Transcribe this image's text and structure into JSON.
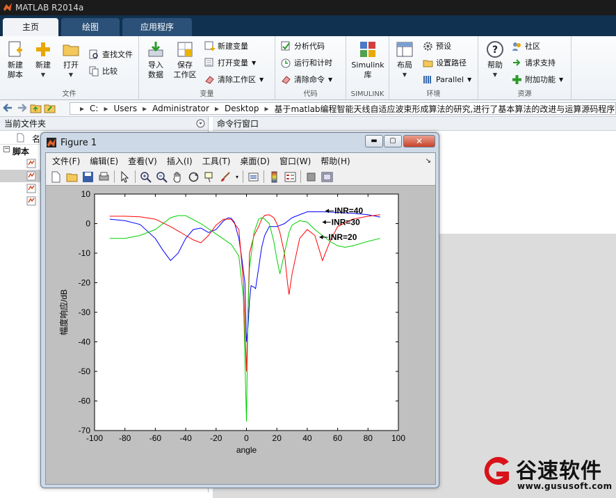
{
  "app": {
    "title": "MATLAB R2014a"
  },
  "tabs": [
    {
      "label": "主页"
    },
    {
      "label": "绘图"
    },
    {
      "label": "应用程序"
    }
  ],
  "ribbon": {
    "file": {
      "group": "文件",
      "new_script": "新建\n脚本",
      "new": "新建",
      "open": "打开",
      "find_files": "查找文件",
      "compare": "比较"
    },
    "variable": {
      "group": "变量",
      "import": "导入\n数据",
      "save_ws": "保存\n工作区",
      "new_var": "新建变量",
      "open_var": "打开变量",
      "clear_ws": "清除工作区"
    },
    "code": {
      "group": "代码",
      "analyze": "分析代码",
      "run_time": "运行和计时",
      "clear_cmd": "清除命令"
    },
    "simulink": {
      "group": "SIMULINK",
      "simulink_lib": "Simulink\n库"
    },
    "env": {
      "group": "环境",
      "layout": "布局",
      "prefs": "预设",
      "set_path": "设置路径",
      "parallel": "Parallel"
    },
    "resources": {
      "group": "资源",
      "help": "帮助",
      "community": "社区",
      "support": "请求支持",
      "addons": "附加功能"
    }
  },
  "address": {
    "crumbs": [
      "C:",
      "Users",
      "Administrator",
      "Desktop",
      "基于matlab编程智能天线自适应波束形成算法的研究,进行了基本算法的改进与运算源码程序"
    ]
  },
  "left_panel": {
    "title": "当前文件夹",
    "col_header": "名",
    "tree_root": "脚本"
  },
  "right_panel": {
    "title": "命令行窗口"
  },
  "figure": {
    "title": "Figure 1",
    "menus": [
      "文件(F)",
      "编辑(E)",
      "查看(V)",
      "插入(I)",
      "工具(T)",
      "桌面(D)",
      "窗口(W)",
      "帮助(H)"
    ]
  },
  "chart_data": {
    "type": "line",
    "xlabel": "angle",
    "ylabel": "幅度响应/dB",
    "xlim": [
      -100,
      100
    ],
    "ylim": [
      -70,
      10
    ],
    "xticks": [
      -100,
      -80,
      -60,
      -40,
      -20,
      0,
      20,
      40,
      60,
      80,
      100
    ],
    "yticks": [
      10,
      0,
      -10,
      -20,
      -30,
      -40,
      -50,
      -60,
      -70
    ],
    "grid": false,
    "annotations": [
      {
        "text": "INR=40",
        "x": 52,
        "y": 4.3
      },
      {
        "text": "INR=30",
        "x": 50,
        "y": 0.5
      },
      {
        "text": "INR=20",
        "x": 48,
        "y": -4.6
      }
    ],
    "series": [
      {
        "color": "#0000ff",
        "x": [
          -90,
          -80,
          -70,
          -60,
          -55,
          -50,
          -45,
          -40,
          -35,
          -30,
          -25,
          -20,
          -15,
          -12,
          -10,
          -8,
          -5,
          -3,
          -1,
          0,
          1,
          2,
          3,
          5,
          6,
          8,
          10,
          12,
          15,
          20,
          25,
          30,
          40,
          50,
          60,
          70,
          80,
          88
        ],
        "y": [
          1.5,
          1,
          -0.3,
          -5,
          -9,
          -12.5,
          -10,
          -5,
          -2,
          -1.5,
          -3,
          -2,
          1,
          2,
          1.8,
          0.5,
          -5,
          -12,
          -20,
          -40,
          -35,
          -26,
          -21,
          -21.5,
          -22,
          -15,
          -8,
          -4,
          -1,
          -1,
          0,
          2,
          4,
          4,
          3.8,
          3.5,
          3,
          2.2
        ]
      },
      {
        "color": "#ff0000",
        "x": [
          -90,
          -80,
          -70,
          -60,
          -50,
          -45,
          -40,
          -35,
          -30,
          -25,
          -20,
          -15,
          -10,
          -5,
          -2,
          0,
          2,
          5,
          8,
          10,
          12,
          15,
          18,
          20,
          22,
          25,
          27,
          28,
          30,
          35,
          40,
          45,
          48,
          50,
          55,
          60,
          70,
          80,
          88
        ],
        "y": [
          2.5,
          2.5,
          2.3,
          1.5,
          -1,
          -2.5,
          -4,
          -5.5,
          -6.5,
          -4,
          -0.5,
          1.5,
          1.5,
          -2,
          -20,
          -50,
          -10,
          -4,
          -1,
          1.5,
          2.8,
          3,
          2,
          0,
          -3,
          -10,
          -20,
          -24,
          -17,
          -5,
          -2,
          -4,
          -9,
          -12.5,
          -6,
          -1,
          1.5,
          2.5,
          3
        ]
      },
      {
        "color": "#00d000",
        "x": [
          -90,
          -80,
          -70,
          -60,
          -55,
          -50,
          -45,
          -40,
          -30,
          -20,
          -10,
          -5,
          -2,
          0,
          1,
          2,
          5,
          8,
          10,
          12,
          15,
          18,
          20,
          22,
          25,
          28,
          30,
          35,
          40,
          45,
          50,
          55,
          60,
          65,
          70,
          80,
          88
        ],
        "y": [
          -5,
          -5,
          -4,
          -2,
          0,
          2,
          2.7,
          2.7,
          0,
          -3.5,
          -7,
          -11,
          -25,
          -67,
          -30,
          -15,
          -3,
          1.5,
          2,
          1.5,
          0,
          -6,
          -12,
          -17,
          -10,
          -3,
          -0.5,
          1,
          0.5,
          -2,
          -4,
          -6,
          -7.5,
          -8,
          -7.5,
          -6,
          -5
        ]
      }
    ]
  },
  "watermark": {
    "brand": "谷速软件",
    "url": "www.gususoft.com"
  }
}
